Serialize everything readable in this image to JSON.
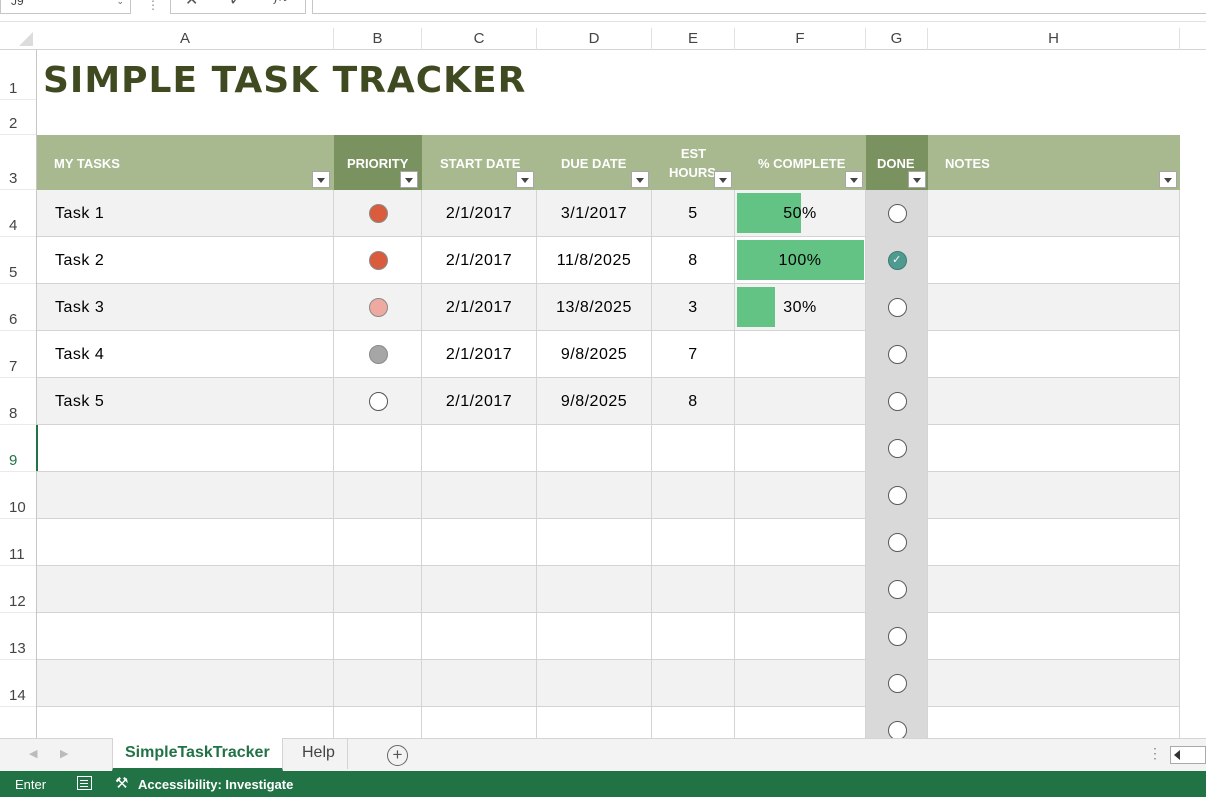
{
  "formula_bar": {
    "name_box": "J9",
    "cancel_icon": "✕",
    "enter_icon": "✓",
    "fx_label": "fx",
    "value": ""
  },
  "columns": [
    "A",
    "B",
    "C",
    "D",
    "E",
    "F",
    "G",
    "H"
  ],
  "rows": [
    "1",
    "2",
    "3",
    "4",
    "5",
    "6",
    "7",
    "8",
    "9",
    "10",
    "11",
    "12",
    "13",
    "14"
  ],
  "title": "SIMPLE TASK TRACKER",
  "table": {
    "headers": {
      "task": "MY TASKS",
      "priority": "PRIORITY",
      "start": "START DATE",
      "due": "DUE DATE",
      "est_line1": "EST",
      "est_line2": "HOURS",
      "pct": "% COMPLETE",
      "done": "DONE",
      "notes": "NOTES"
    },
    "priority_colors": {
      "high": "#d95c3c",
      "medium": "#eeaaa0",
      "low": "#a6a6a6",
      "none": "#ffffff"
    },
    "rows": [
      {
        "task": "Task 1",
        "priority": "high",
        "start": "2/1/2017",
        "due": "3/1/2017",
        "est": "5",
        "pct": 50,
        "pct_label": "50%",
        "done": false
      },
      {
        "task": "Task 2",
        "priority": "high",
        "start": "2/1/2017",
        "due": "11/8/2025",
        "est": "8",
        "pct": 100,
        "pct_label": "100%",
        "done": true
      },
      {
        "task": "Task 3",
        "priority": "medium",
        "start": "2/1/2017",
        "due": "13/8/2025",
        "est": "3",
        "pct": 30,
        "pct_label": "30%",
        "done": false
      },
      {
        "task": "Task 4",
        "priority": "low",
        "start": "2/1/2017",
        "due": "9/8/2025",
        "est": "7",
        "pct": null,
        "pct_label": "",
        "done": false
      },
      {
        "task": "Task 5",
        "priority": "none",
        "start": "2/1/2017",
        "due": "9/8/2025",
        "est": "8",
        "pct": null,
        "pct_label": "",
        "done": false
      }
    ],
    "empty_rows": 7
  },
  "sheet_tabs": {
    "active": "SimpleTaskTracker",
    "other": "Help",
    "add_icon": "+"
  },
  "status_bar": {
    "mode": "Enter",
    "accessibility": "Accessibility: Investigate"
  }
}
